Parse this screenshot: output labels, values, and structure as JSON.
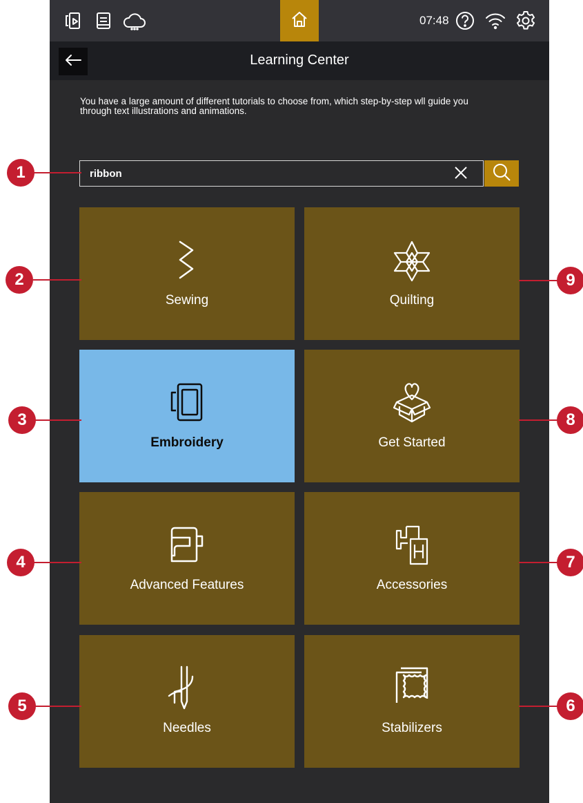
{
  "status_bar": {
    "time": "07:48",
    "left_icons": [
      "machine-ui-icon",
      "manual-icon",
      "cloud-icon"
    ],
    "right_icons": [
      "help-icon",
      "wifi-icon",
      "settings-icon"
    ],
    "accent_color": "#b8860b"
  },
  "title_bar": {
    "title": "Learning Center"
  },
  "description": "You have a large amount of different tutorials to choose from, which step-by-step wll guide you through text illustrations and animations.",
  "search": {
    "value": "ribbon"
  },
  "tiles": [
    {
      "label": "Sewing",
      "icon": "zigzag-stitch-icon",
      "selected": false
    },
    {
      "label": "Quilting",
      "icon": "quilt-star-icon",
      "selected": false
    },
    {
      "label": "Embroidery",
      "icon": "embroidery-hoop-icon",
      "selected": true
    },
    {
      "label": "Get Started",
      "icon": "gift-box-icon",
      "selected": false
    },
    {
      "label": "Advanced Features",
      "icon": "sewing-machine-icon",
      "selected": false
    },
    {
      "label": "Accessories",
      "icon": "presser-feet-icon",
      "selected": false
    },
    {
      "label": "Needles",
      "icon": "needle-thread-icon",
      "selected": false
    },
    {
      "label": "Stabilizers",
      "icon": "stabilizer-icon",
      "selected": false
    }
  ],
  "callouts": [
    "1",
    "2",
    "3",
    "4",
    "5",
    "6",
    "7",
    "8",
    "9"
  ]
}
